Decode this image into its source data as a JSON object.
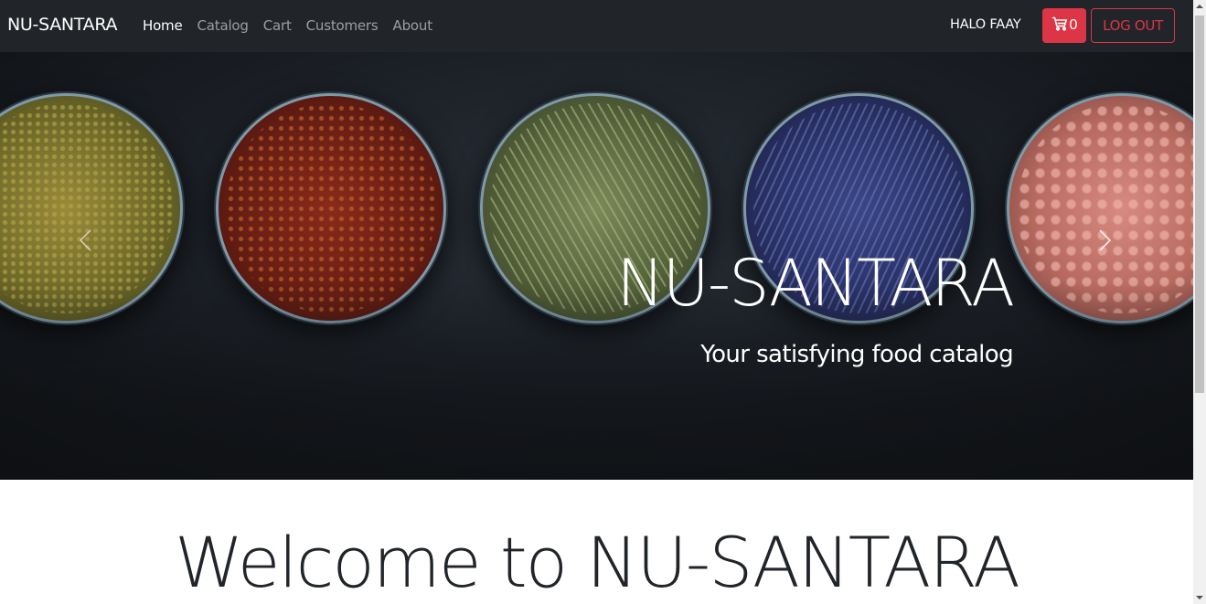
{
  "navbar": {
    "brand": "NU-SANTARA",
    "links": [
      {
        "label": "Home",
        "active": true
      },
      {
        "label": "Catalog",
        "active": false
      },
      {
        "label": "Cart",
        "active": false
      },
      {
        "label": "Customers",
        "active": false
      },
      {
        "label": "About",
        "active": false
      }
    ],
    "greeting": "HALO FAAY",
    "cart": {
      "icon": "shopping-cart-icon",
      "count": "0"
    },
    "logout_label": "LOG OUT",
    "colors": {
      "background": "#212529",
      "danger": "#dc3545"
    }
  },
  "hero": {
    "title": "NU-SANTARA",
    "subtitle": "Your satisfying food catalog",
    "prev_icon": "chevron-left-icon",
    "next_icon": "chevron-right-icon"
  },
  "main": {
    "welcome": "Welcome to NU-SANTARA"
  }
}
